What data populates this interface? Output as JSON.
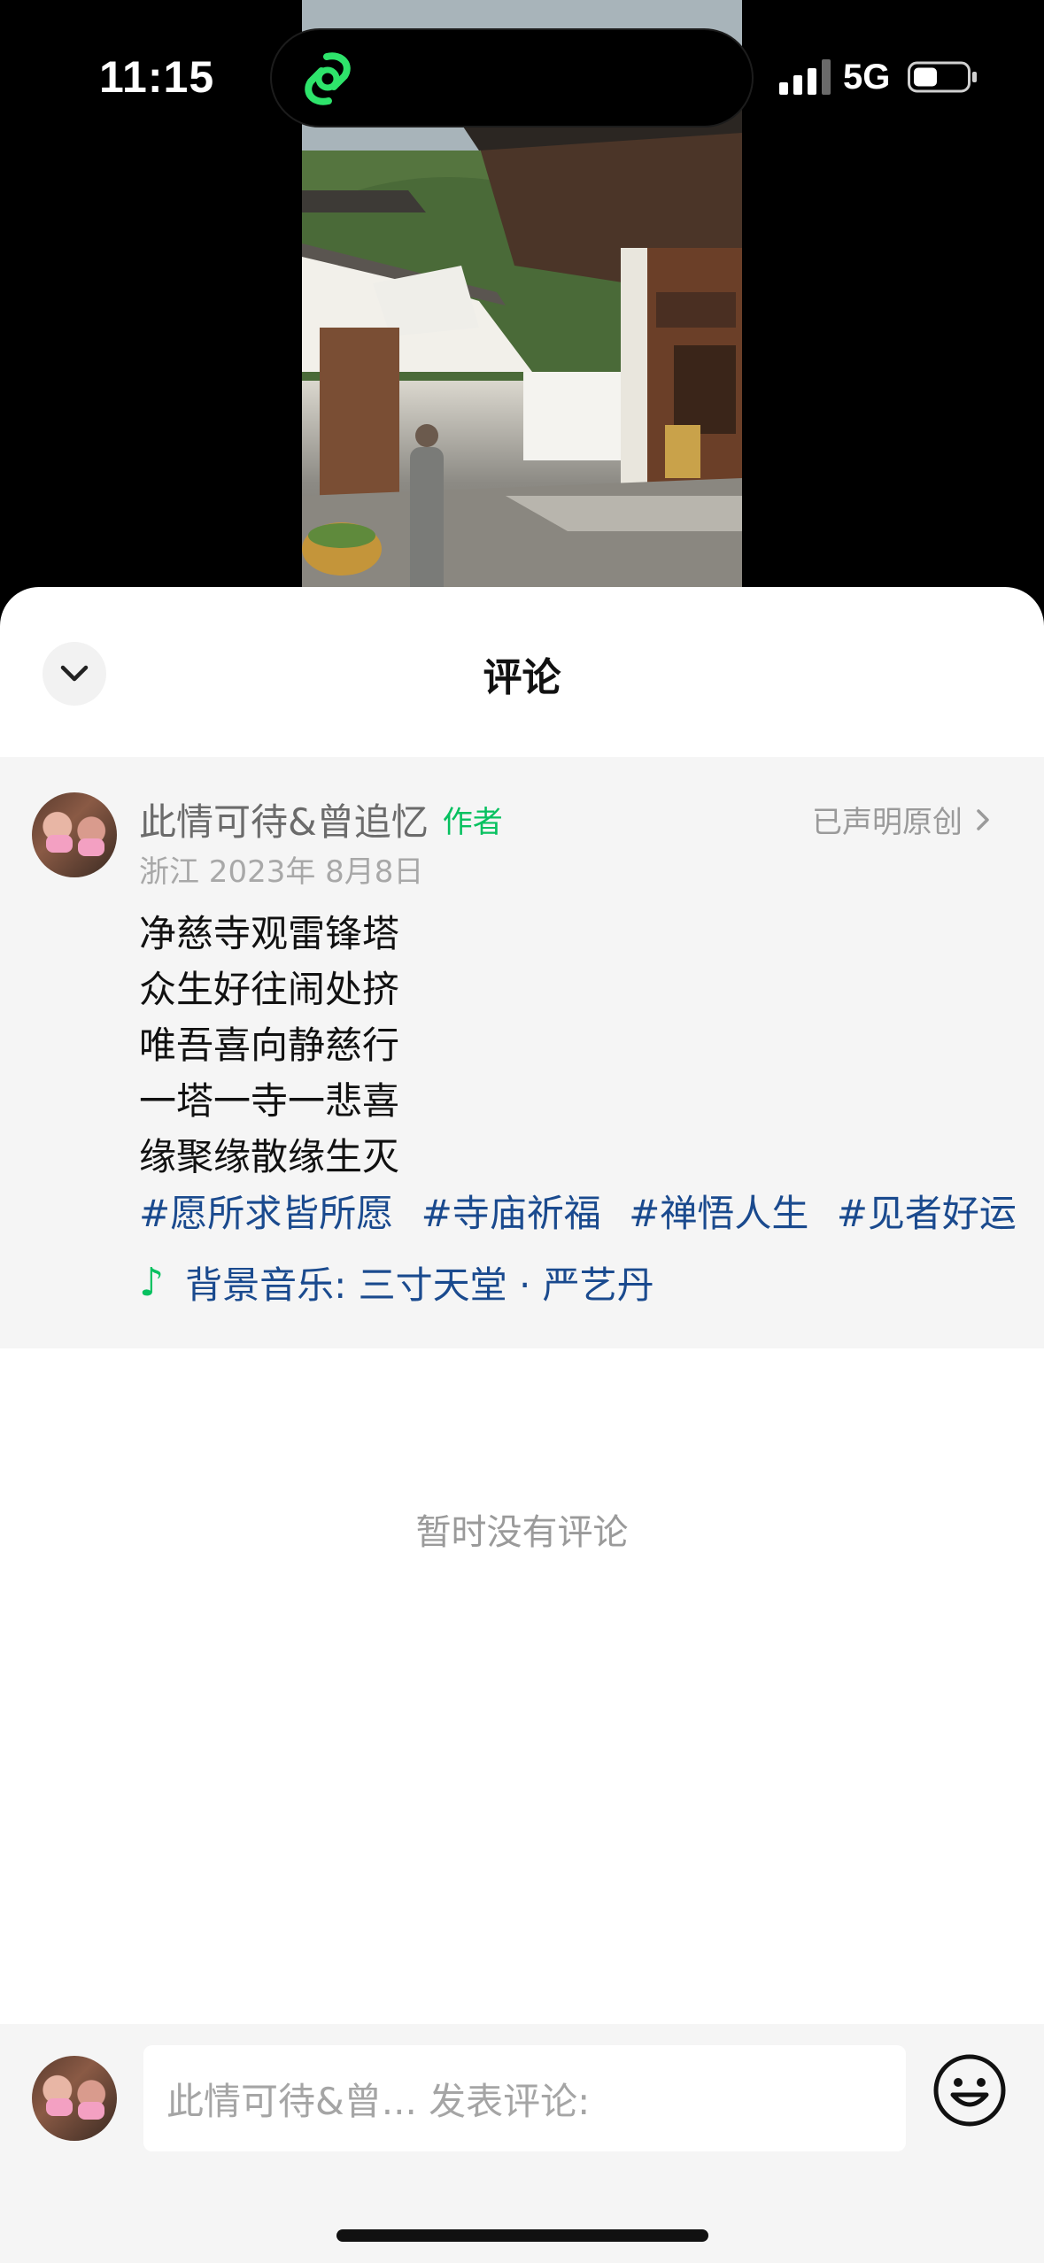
{
  "status_bar": {
    "time": "11:15",
    "network": "5G",
    "signal_icon": "signal-bars-icon",
    "battery_icon": "battery-icon",
    "island_icon": "wechat-channels-link-icon"
  },
  "video": {
    "description_icon": "temple-photo"
  },
  "sheet": {
    "title": "评论",
    "collapse_icon": "chevron-down-icon"
  },
  "post": {
    "author_name": "此情可待&曾追忆",
    "author_tag": "作者",
    "original_label": "已声明原创",
    "meta": "浙江 2023年 8月8日",
    "lines": [
      "净慈寺观雷锋塔",
      "众生好往闹处挤",
      "唯吾喜向静慈行",
      "一塔一寺一悲喜",
      "缘聚缘散缘生灭"
    ],
    "tags": [
      "#愿所求皆所愿",
      "#寺庙祈福",
      "#禅悟人生",
      "#见者好运"
    ],
    "music_icon": "♪",
    "music": "背景音乐: 三寸天堂 · 严艺丹"
  },
  "empty_text": "暂时没有评论",
  "comment_bar": {
    "placeholder": "此情可待&曾... 发表评论:",
    "emoji_icon": "smiley-icon"
  },
  "colors": {
    "accent_green": "#07c160",
    "link_blue": "#1a4a8e",
    "panel_gray": "#f5f5f5"
  }
}
